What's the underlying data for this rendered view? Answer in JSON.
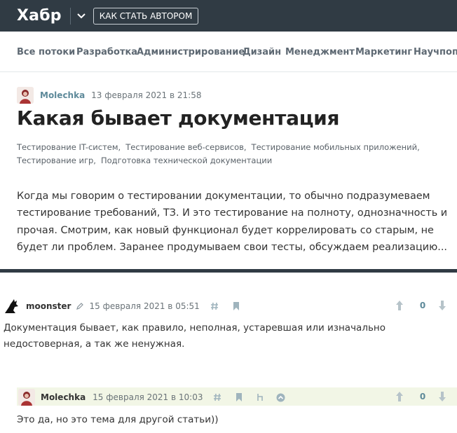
{
  "header": {
    "logo": "Хабр",
    "author_button": "КАК СТАТЬ АВТОРОМ"
  },
  "nav": {
    "items": [
      "Все потоки",
      "Разработка",
      "Администрирование",
      "Дизайн",
      "Менеджмент",
      "Маркетинг",
      "Научпоп"
    ]
  },
  "article": {
    "author": "Molechka",
    "date": "13 февраля 2021 в 21:58",
    "title": "Какая бывает документация",
    "hubs": [
      "Тестирование IT-систем,",
      "Тестирование веб-сервисов,",
      "Тестирование мобильных приложений,",
      "Тестирование игр,",
      "Подготовка технической документации"
    ],
    "lead": "Когда мы говорим о тестировании документации, то обычно подразумеваем тестирование требований, ТЗ. И это тестирование на полноту, однозначность и прочая. Смотрим, как новый функционал будет коррелировать со старым, не будет ли проблем. Заранее продумываем свои тесты, обсуждаем реализацию..."
  },
  "comments": [
    {
      "user": "moonster",
      "date": "15 февраля 2021 в 05:51",
      "score": "0",
      "text_line1": "Документация бывает, как правило, неполная, устаревшая или изначально",
      "text_line2": "недостоверная, а так же ненужная."
    },
    {
      "user": "Molechka",
      "date": "15 февраля 2021 в 10:03",
      "score": "0",
      "text": "Это да, но это тема для другой статьи))"
    }
  ],
  "colors": {
    "header_bg": "#303b44",
    "link": "#5e8a9a",
    "reply_highlight": "#f2f6e6"
  }
}
